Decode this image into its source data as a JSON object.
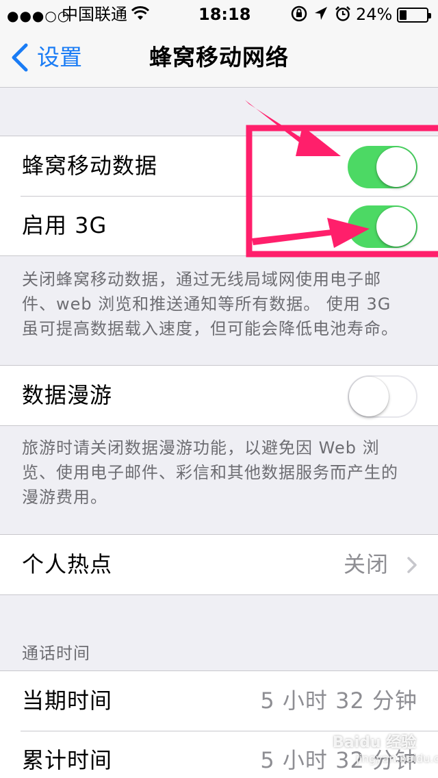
{
  "status_bar": {
    "signal": "●●●○○",
    "carrier": "中国联通",
    "time": "18:18",
    "battery_percent": "24%",
    "battery_level": 0.24,
    "icons": [
      "signal-dots-icon",
      "wifi-icon",
      "orientation-lock-icon",
      "location-icon",
      "alarm-icon",
      "battery-icon"
    ]
  },
  "nav": {
    "back_label": "设置",
    "title": "蜂窝移动网络"
  },
  "group1": {
    "cellular_data": {
      "label": "蜂窝移动数据",
      "on": true
    },
    "enable_3g": {
      "label": "启用 3G",
      "on": true
    }
  },
  "footnote1": "关闭蜂窝移动数据，通过无线局域网使用电子邮件、web 浏览和推送通知等所有数据。 使用 3G 虽可提高数据载入速度，但可能会降低电池寿命。",
  "group2": {
    "roaming": {
      "label": "数据漫游",
      "on": false
    }
  },
  "footnote2": "旅游时请关闭数据漫游功能，以避免因 Web 浏览、使用电子邮件、彩信和其他数据服务而产生的漫游费用。",
  "group3": {
    "hotspot": {
      "label": "个人热点",
      "value": "关闭"
    }
  },
  "call_time": {
    "header": "通话时间",
    "current": {
      "label": "当期时间",
      "value": "5 小时 32 分钟"
    },
    "lifetime": {
      "label": "累计时间",
      "value": "5 小时 32 分钟"
    }
  },
  "colors": {
    "accent": "#1a7cf5",
    "toggle_on": "#4cd964",
    "annotation": "#ff1f6b",
    "background": "#efeff4"
  },
  "watermark": "Baidu 经验",
  "watermark_sub": "jingyan.baidu.com"
}
